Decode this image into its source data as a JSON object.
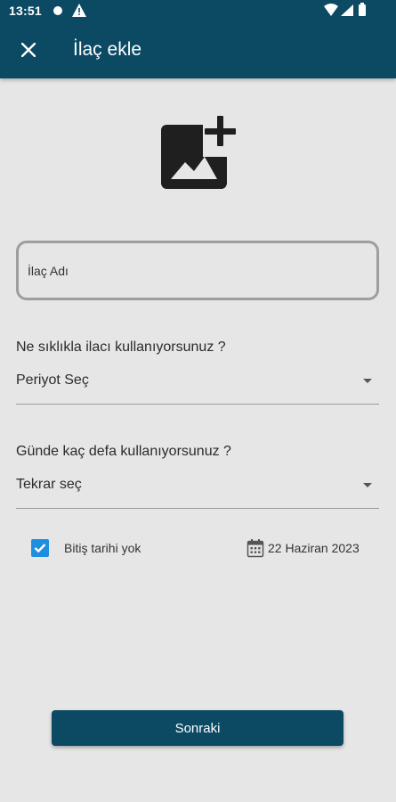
{
  "status_bar": {
    "time": "13:51",
    "icons": [
      "notification-dot-icon",
      "warning-icon",
      "wifi-icon",
      "signal-icon",
      "battery-icon"
    ]
  },
  "app_bar": {
    "title": "İlaç ekle",
    "close_icon": "close-icon",
    "background_color": "#0c4a64"
  },
  "image_picker": {
    "icon": "add-photo-icon"
  },
  "name_field": {
    "placeholder": "İlaç Adı",
    "value": ""
  },
  "frequency": {
    "question": "Ne sıklıkla ilacı kullanıyorsunuz ?",
    "selected": "Periyot Seç"
  },
  "daily_count": {
    "question": "Günde kaç defa kullanıyorsunuz ?",
    "selected": "Tekrar seç"
  },
  "end_date": {
    "no_end_label": "Bitiş tarihi yok",
    "no_end_checked": true,
    "date": "22 Haziran 2023",
    "checkbox_color": "#1e8fe0"
  },
  "actions": {
    "next_label": "Sonraki"
  }
}
